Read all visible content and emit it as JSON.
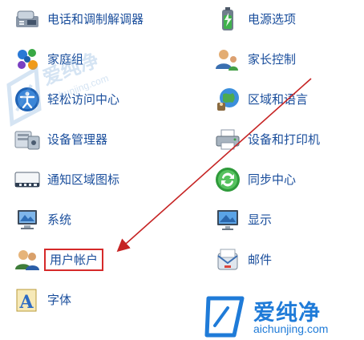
{
  "left_items": [
    {
      "label": "电话和调制解调器",
      "icon": "phone-modem-icon"
    },
    {
      "label": "家庭组",
      "icon": "homegroup-icon"
    },
    {
      "label": "轻松访问中心",
      "icon": "ease-of-access-icon"
    },
    {
      "label": "设备管理器",
      "icon": "device-manager-icon"
    },
    {
      "label": "通知区域图标",
      "icon": "notification-area-icon"
    },
    {
      "label": "系统",
      "icon": "system-icon"
    },
    {
      "label": "用户帐户",
      "icon": "user-accounts-icon"
    },
    {
      "label": "字体",
      "icon": "fonts-icon"
    }
  ],
  "right_items": [
    {
      "label": "电源选项",
      "icon": "power-options-icon"
    },
    {
      "label": "家长控制",
      "icon": "parental-controls-icon"
    },
    {
      "label": "区域和语言",
      "icon": "region-language-icon"
    },
    {
      "label": "设备和打印机",
      "icon": "devices-printers-icon"
    },
    {
      "label": "同步中心",
      "icon": "sync-center-icon"
    },
    {
      "label": "显示",
      "icon": "display-icon"
    },
    {
      "label": "邮件",
      "icon": "mail-icon"
    }
  ],
  "highlight": {
    "label": "用户帐户",
    "color": "#d62a2a"
  },
  "watermark": {
    "brand": "爱纯净",
    "url": "aichunjing.com",
    "color": "#1f7bd8"
  },
  "colors": {
    "link": "#1a4e9c",
    "annotation": "#c62424"
  }
}
